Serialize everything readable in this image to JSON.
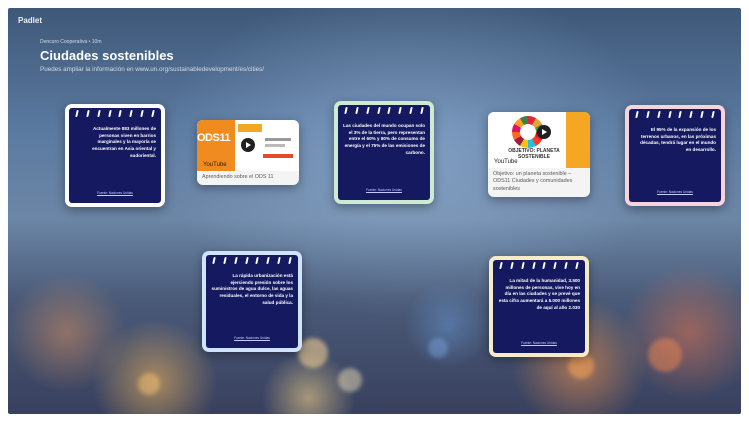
{
  "app": {
    "brand": "Padlet"
  },
  "header": {
    "breadcrumb": "Dencuro Cooperativa • 10m",
    "title": "Ciudades sostenibles",
    "subtitle": "Puedes ampliar la información en www.un.org/sustainabledevelopment/es/cities/"
  },
  "posts": [
    {
      "kind": "note",
      "text": "Actualmente 883 millones de personas viven en barrios marginales y la mayoría se encuentran en Asia oriental y sudoriental.",
      "source": "Fuente: Naciones Unidas",
      "border_color": "#ffffff"
    },
    {
      "kind": "video",
      "thumb_label": "ODS11",
      "provider": "YouTube",
      "caption": "Aprendiendo sobre el ODS 11"
    },
    {
      "kind": "note",
      "text": "Las ciudades del mundo ocupan solo el 3% de la tierra, pero representan entre el 60% y 80% de consumo de energía y el 75% de las emisiones de carbono.",
      "source": "Fuente: Naciones Unidas",
      "border_color": "#cdebd2"
    },
    {
      "kind": "video",
      "thumb_label": "OBJETIVO: PLANETA SOSTENIBLE",
      "provider": "YouTube",
      "caption": "Objetivo: un planeta sostenible – ODS11 Ciudades y comunidades sostenibles"
    },
    {
      "kind": "note",
      "text": "El 95% de la expansión de los terrenos urbanos, en las próximas décadas, tendrá lugar en el mundo en desarrollo.",
      "source": "Fuente: Naciones Unidas",
      "border_color": "#f6d3dd"
    },
    {
      "kind": "note",
      "text": "La rápida urbanización está ejerciendo presión sobre los suministros de agua dulce, las aguas residuales, el entorno de vida y la salud pública.",
      "source": "Fuente: Naciones Unidas",
      "border_color": "#cfe3fb"
    },
    {
      "kind": "note",
      "text": "La mitad de la humanidad, 3.500 millones de personas, vive hoy en día en las ciudades y se prevé que esta cifra aumentará a 5.000 millones de aquí al año 2.030",
      "source": "Fuente: Naciones Unidas",
      "border_color": "#f6ebc8"
    }
  ],
  "colors": {
    "note_background": "#151a60",
    "ods_orange": "#f08c1f",
    "ods_yellow": "#f5a623"
  }
}
